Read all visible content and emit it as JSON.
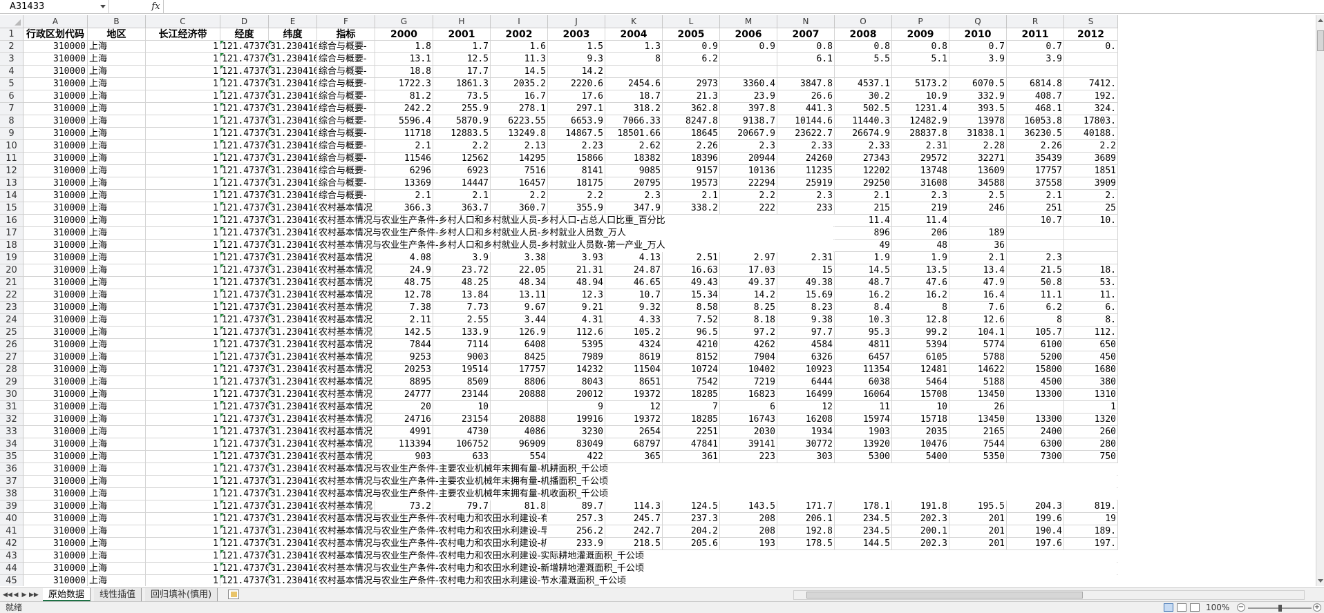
{
  "name_box": "A31433",
  "fx_label": "fx",
  "formula_value": "",
  "columns": [
    "A",
    "B",
    "C",
    "D",
    "E",
    "F",
    "G",
    "H",
    "I",
    "J",
    "K",
    "L",
    "M",
    "N",
    "O",
    "P",
    "Q",
    "R",
    "S"
  ],
  "header_row": [
    "行政区划代码",
    "地区",
    "长江经济带",
    "经度",
    "纬度",
    "指标",
    "2000",
    "2001",
    "2002",
    "2003",
    "2004",
    "2005",
    "2006",
    "2007",
    "2008",
    "2009",
    "2010",
    "2011",
    "2012"
  ],
  "rows": [
    {
      "n": "2",
      "F": "综合与概要-",
      "v": [
        "1.8",
        "1.7",
        "1.6",
        "1.5",
        "1.3",
        "0.9",
        "0.9",
        "0.8",
        "0.8",
        "0.8",
        "0.7",
        "0.7",
        "0."
      ]
    },
    {
      "n": "3",
      "F": "综合与概要-",
      "v": [
        "13.1",
        "12.5",
        "11.3",
        "9.3",
        "8",
        "6.2",
        "",
        "6.1",
        "5.5",
        "5.1",
        "3.9",
        "3.9",
        ""
      ]
    },
    {
      "n": "4",
      "F": "综合与概要-",
      "v": [
        "18.8",
        "17.7",
        "14.5",
        "14.2",
        "",
        "",
        "",
        "",
        "",
        "",
        "",
        "",
        ""
      ]
    },
    {
      "n": "5",
      "F": "综合与概要-",
      "v": [
        "1722.3",
        "1861.3",
        "2035.2",
        "2220.6",
        "2454.6",
        "2973",
        "3360.4",
        "3847.8",
        "4537.1",
        "5173.2",
        "6070.5",
        "6814.8",
        "7412."
      ]
    },
    {
      "n": "6",
      "F": "综合与概要-",
      "v": [
        "81.2",
        "73.5",
        "16.7",
        "17.6",
        "18.7",
        "21.3",
        "23.9",
        "26.6",
        "30.2",
        "10.9",
        "332.9",
        "408.7",
        "192."
      ]
    },
    {
      "n": "7",
      "F": "综合与概要-",
      "v": [
        "242.2",
        "255.9",
        "278.1",
        "297.1",
        "318.2",
        "362.8",
        "397.8",
        "441.3",
        "502.5",
        "1231.4",
        "393.5",
        "468.1",
        "324."
      ]
    },
    {
      "n": "8",
      "F": "综合与概要-",
      "v": [
        "5596.4",
        "5870.9",
        "6223.55",
        "6653.9",
        "7066.33",
        "8247.8",
        "9138.7",
        "10144.6",
        "11440.3",
        "12482.9",
        "13978",
        "16053.8",
        "17803."
      ]
    },
    {
      "n": "9",
      "F": "综合与概要-",
      "v": [
        "11718",
        "12883.5",
        "13249.8",
        "14867.5",
        "18501.66",
        "18645",
        "20667.9",
        "23622.7",
        "26674.9",
        "28837.8",
        "31838.1",
        "36230.5",
        "40188."
      ]
    },
    {
      "n": "10",
      "F": "综合与概要-",
      "v": [
        "2.1",
        "2.2",
        "2.13",
        "2.23",
        "2.62",
        "2.26",
        "2.3",
        "2.33",
        "2.33",
        "2.31",
        "2.28",
        "2.26",
        "2.2"
      ]
    },
    {
      "n": "11",
      "F": "综合与概要-",
      "v": [
        "11546",
        "12562",
        "14295",
        "15866",
        "18382",
        "18396",
        "20944",
        "24260",
        "27343",
        "29572",
        "32271",
        "35439",
        "3689"
      ]
    },
    {
      "n": "12",
      "F": "综合与概要-",
      "v": [
        "6296",
        "6923",
        "7516",
        "8141",
        "9085",
        "9157",
        "10136",
        "11235",
        "12202",
        "13748",
        "13609",
        "17757",
        "1851"
      ]
    },
    {
      "n": "13",
      "F": "综合与概要-",
      "v": [
        "13369",
        "14447",
        "16457",
        "18175",
        "20795",
        "19573",
        "22294",
        "25919",
        "29250",
        "31608",
        "34588",
        "37558",
        "3909"
      ]
    },
    {
      "n": "14",
      "F": "综合与概要-",
      "v": [
        "2.1",
        "2.1",
        "2.2",
        "2.2",
        "2.3",
        "2.1",
        "2.2",
        "2.3",
        "2.1",
        "2.3",
        "2.5",
        "2.1",
        "2."
      ]
    },
    {
      "n": "15",
      "F": "农村基本情况",
      "v": [
        "366.3",
        "363.7",
        "360.7",
        "355.9",
        "347.9",
        "338.2",
        "222",
        "233",
        "215",
        "219",
        "246",
        "251",
        "25"
      ]
    },
    {
      "n": "16",
      "F": "农村基本情况与农业生产条件-乡村人口和乡村就业人员-乡村人口-占总人口比重_百分比",
      "spill": true,
      "v": [
        "",
        "",
        "",
        "",
        "",
        "",
        "",
        "",
        "11.4",
        "11.4",
        "",
        "10.7",
        "10."
      ]
    },
    {
      "n": "17",
      "F": "农村基本情况与农业生产条件-乡村人口和乡村就业人员-乡村就业人员数_万人",
      "spill": true,
      "v": [
        "",
        "",
        "",
        "",
        "",
        "",
        "",
        "",
        "896",
        "206",
        "189",
        "",
        ""
      ]
    },
    {
      "n": "18",
      "F": "农村基本情况与农业生产条件-乡村人口和乡村就业人员-乡村就业人员数-第一产业_万人",
      "spill": true,
      "v": [
        "",
        "",
        "",
        "",
        "",
        "",
        "",
        "",
        "49",
        "48",
        "36",
        "",
        ""
      ]
    },
    {
      "n": "19",
      "F": "农村基本情况",
      "v": [
        "4.08",
        "3.9",
        "3.38",
        "3.93",
        "4.13",
        "2.51",
        "2.97",
        "2.31",
        "1.9",
        "1.9",
        "2.1",
        "2.3",
        ""
      ]
    },
    {
      "n": "20",
      "F": "农村基本情况",
      "v": [
        "24.9",
        "23.72",
        "22.05",
        "21.31",
        "24.87",
        "16.63",
        "17.03",
        "15",
        "14.5",
        "13.5",
        "13.4",
        "21.5",
        "18."
      ]
    },
    {
      "n": "21",
      "F": "农村基本情况",
      "v": [
        "48.75",
        "48.25",
        "48.34",
        "48.94",
        "46.65",
        "49.43",
        "49.37",
        "49.38",
        "48.7",
        "47.6",
        "47.9",
        "50.8",
        "53."
      ]
    },
    {
      "n": "22",
      "F": "农村基本情况",
      "v": [
        "12.78",
        "13.84",
        "13.11",
        "12.3",
        "10.7",
        "15.34",
        "14.2",
        "15.69",
        "16.2",
        "16.2",
        "16.4",
        "11.1",
        "11."
      ]
    },
    {
      "n": "23",
      "F": "农村基本情况",
      "v": [
        "7.38",
        "7.73",
        "9.67",
        "9.21",
        "9.32",
        "8.58",
        "8.25",
        "8.23",
        "8.4",
        "8",
        "7.6",
        "6.2",
        "6."
      ]
    },
    {
      "n": "24",
      "F": "农村基本情况",
      "v": [
        "2.11",
        "2.55",
        "3.44",
        "4.31",
        "4.33",
        "7.52",
        "8.18",
        "9.38",
        "10.3",
        "12.8",
        "12.6",
        "8",
        "8."
      ]
    },
    {
      "n": "25",
      "F": "农村基本情况",
      "v": [
        "142.5",
        "133.9",
        "126.9",
        "112.6",
        "105.2",
        "96.5",
        "97.2",
        "97.7",
        "95.3",
        "99.2",
        "104.1",
        "105.7",
        "112."
      ]
    },
    {
      "n": "26",
      "F": "农村基本情况",
      "v": [
        "7844",
        "7114",
        "6408",
        "5395",
        "4324",
        "4210",
        "4262",
        "4584",
        "4811",
        "5394",
        "5774",
        "6100",
        "650"
      ]
    },
    {
      "n": "27",
      "F": "农村基本情况",
      "v": [
        "9253",
        "9003",
        "8425",
        "7989",
        "8619",
        "8152",
        "7904",
        "6326",
        "6457",
        "6105",
        "5788",
        "5200",
        "450"
      ]
    },
    {
      "n": "28",
      "F": "农村基本情况",
      "v": [
        "20253",
        "19514",
        "17757",
        "14232",
        "11504",
        "10724",
        "10402",
        "10923",
        "11354",
        "12481",
        "14622",
        "15800",
        "1680"
      ]
    },
    {
      "n": "29",
      "F": "农村基本情况",
      "v": [
        "8895",
        "8509",
        "8806",
        "8043",
        "8651",
        "7542",
        "7219",
        "6444",
        "6038",
        "5464",
        "5188",
        "4500",
        "380"
      ]
    },
    {
      "n": "30",
      "F": "农村基本情况",
      "v": [
        "24777",
        "23144",
        "20888",
        "20012",
        "19372",
        "18285",
        "16823",
        "16499",
        "16064",
        "15708",
        "13450",
        "13300",
        "1310"
      ]
    },
    {
      "n": "31",
      "F": "农村基本情况",
      "v": [
        "20",
        "10",
        "",
        "9",
        "12",
        "7",
        "6",
        "12",
        "11",
        "10",
        "26",
        "",
        "1"
      ]
    },
    {
      "n": "32",
      "F": "农村基本情况",
      "v": [
        "24716",
        "23154",
        "20888",
        "19916",
        "19372",
        "18285",
        "16743",
        "16208",
        "15974",
        "15718",
        "13450",
        "13300",
        "1320"
      ]
    },
    {
      "n": "33",
      "F": "农村基本情况",
      "v": [
        "4991",
        "4730",
        "4086",
        "3230",
        "2654",
        "2251",
        "2030",
        "1934",
        "1903",
        "2035",
        "2165",
        "2400",
        "260"
      ]
    },
    {
      "n": "34",
      "F": "农村基本情况",
      "v": [
        "113394",
        "106752",
        "96909",
        "83049",
        "68797",
        "47841",
        "39141",
        "30772",
        "13920",
        "10476",
        "7544",
        "6300",
        "280"
      ]
    },
    {
      "n": "35",
      "F": "农村基本情况",
      "v": [
        "903",
        "633",
        "554",
        "422",
        "365",
        "361",
        "223",
        "303",
        "5300",
        "5400",
        "5350",
        "7300",
        "750"
      ]
    },
    {
      "n": "36",
      "F": "农村基本情况与农业生产条件-主要农业机械年末拥有量-机耕面积_千公顷",
      "spill": true,
      "v": [
        "",
        "",
        "",
        "",
        "",
        "",
        "",
        "",
        "",
        "",
        "",
        "",
        ""
      ]
    },
    {
      "n": "37",
      "F": "农村基本情况与农业生产条件-主要农业机械年末拥有量-机播面积_千公顷",
      "spill": true,
      "v": [
        "",
        "",
        "",
        "",
        "",
        "",
        "",
        "",
        "",
        "",
        "",
        "",
        ""
      ]
    },
    {
      "n": "38",
      "F": "农村基本情况与农业生产条件-主要农业机械年末拥有量-机收面积_千公顷",
      "spill": true,
      "v": [
        "",
        "",
        "",
        "",
        "",
        "",
        "",
        "",
        "",
        "",
        "",
        "",
        ""
      ]
    },
    {
      "n": "39",
      "F": "农村基本情况",
      "v": [
        "73.2",
        "79.7",
        "81.8",
        "89.7",
        "114.3",
        "124.5",
        "143.5",
        "171.7",
        "178.1",
        "191.8",
        "195.5",
        "204.3",
        "819."
      ]
    },
    {
      "n": "40",
      "F": "农村基本情况与农业生产条件-农村电力和农田水利建设-有",
      "spill": true,
      "v": [
        "",
        "",
        "",
        "257.3",
        "245.7",
        "237.3",
        "208",
        "206.1",
        "234.5",
        "202.3",
        "201",
        "199.6",
        "19"
      ]
    },
    {
      "n": "41",
      "F": "农村基本情况与农业生产条件-农村电力和农田水利建设-早",
      "spill": true,
      "v": [
        "",
        "",
        "",
        "256.2",
        "242.7",
        "204.2",
        "208",
        "192.8",
        "234.5",
        "200.1",
        "201",
        "190.4",
        "189."
      ]
    },
    {
      "n": "42",
      "F": "农村基本情况与农业生产条件-农村电力和农田水利建设-机",
      "spill": true,
      "v": [
        "",
        "",
        "",
        "233.9",
        "218.5",
        "205.6",
        "193",
        "178.5",
        "144.5",
        "202.3",
        "201",
        "197.6",
        "197."
      ]
    },
    {
      "n": "43",
      "F": "农村基本情况与农业生产条件-农村电力和农田水利建设-实际耕地灌溉面积_千公顷",
      "spill": true,
      "v": [
        "",
        "",
        "",
        "",
        "",
        "",
        "",
        "",
        "",
        "",
        "",
        "",
        ""
      ]
    },
    {
      "n": "44",
      "F": "农村基本情况与农业生产条件-农村电力和农田水利建设-新增耕地灌溉面积_千公顷",
      "spill": true,
      "v": [
        "",
        "",
        "",
        "",
        "",
        "",
        "",
        "",
        "",
        "",
        "",
        "",
        ""
      ]
    },
    {
      "n": "45",
      "F": "农村基本情况与农业生产条件-农村电力和农田水利建设-节水灌溉面积_千公顷",
      "spill": true,
      "v": [
        "",
        "",
        "",
        "",
        "",
        "",
        "",
        "",
        "",
        "",
        "",
        "",
        ""
      ]
    }
  ],
  "common": {
    "code": "310000",
    "region": "上海",
    "belt": "1",
    "lon": "121.473701",
    "lat": "31.230416"
  },
  "tabs": [
    "原始数据",
    "线性插值",
    "回归填补(慎用)"
  ],
  "active_tab": 0,
  "status": "就绪",
  "zoom": "100%"
}
